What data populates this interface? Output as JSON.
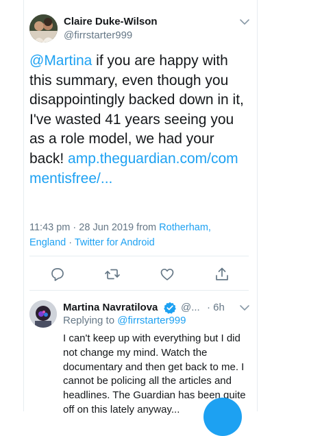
{
  "main_tweet": {
    "author_name": "Claire Duke-Wilson",
    "author_handle": "@firrstarter999",
    "text_mention": "@Martina",
    "text_body": " if you are happy with this summary, even though you disappointingly backed down in it, I've wasted 41 years seeing you as a role model, we had your back! ",
    "link_text": "amp.theguardian.com/commentisfree/...",
    "time": "11:43 pm",
    "date": "28 Jun 2019",
    "from_label": "from",
    "location": "Rotherham, England",
    "source": "Twitter for Android",
    "separator": " · "
  },
  "reply_tweet": {
    "author_name": "Martina Navratilova",
    "author_handle": "@...",
    "time": "· 6h",
    "replying_label": "Replying to",
    "replying_handle": "@firrstarter999",
    "text": "I can't keep up with everything but I did not change my mind. Watch the documentary and then get back to me. I cannot be policing all the articles and headlines. The Guardian has been quite off on this lately anyway..."
  },
  "colors": {
    "accent": "#1da1f2",
    "secondary_text": "#657786",
    "divider": "#e6ecf0"
  },
  "icons": [
    "chevron-down-icon",
    "reply-icon",
    "retweet-icon",
    "like-icon",
    "share-icon",
    "verified-badge-icon"
  ]
}
